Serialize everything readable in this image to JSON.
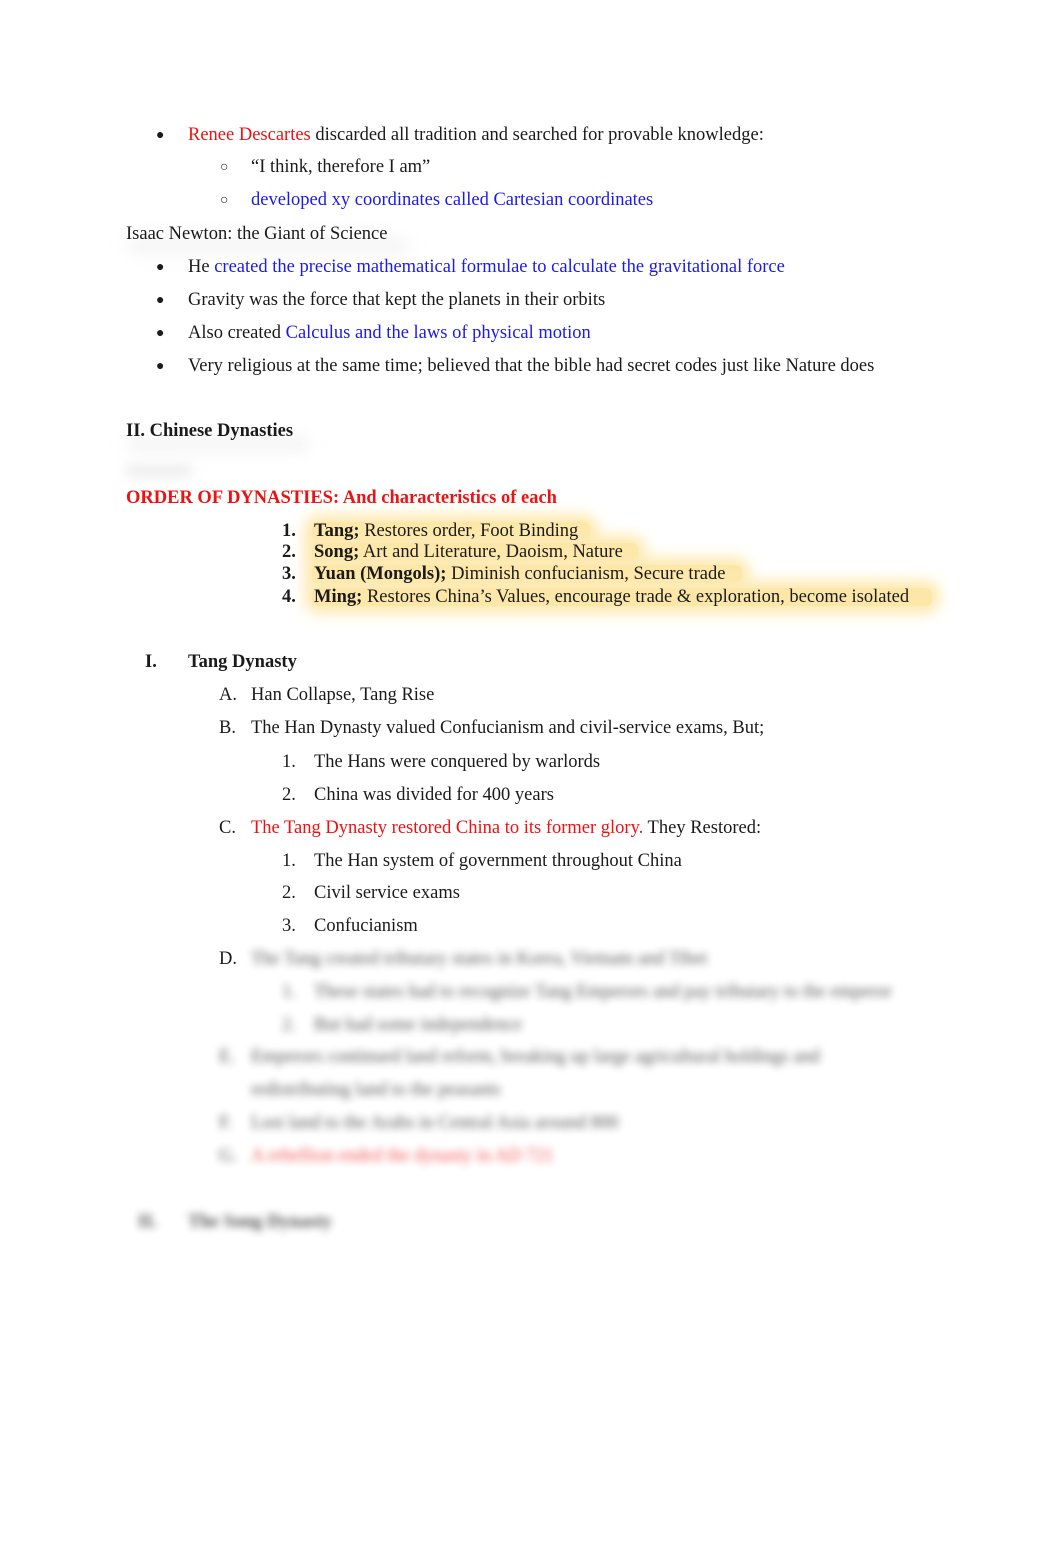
{
  "descartes": {
    "bullet": "●",
    "name": "Renee Descartes",
    "text": " discarded all tradition and searched for provable knowledge:",
    "sub": [
      {
        "marker": "○",
        "text": "“I think, therefore I am”",
        "color": "#1a1a1a"
      },
      {
        "marker": "○",
        "text": "developed xy coordinates called Cartesian coordinates",
        "color": "#1a1aee"
      }
    ]
  },
  "newton": {
    "heading": "Isaac Newton: the Giant of Science",
    "bullets": [
      {
        "marker": "●",
        "plain": "He ",
        "highlight": "created the precise mathematical formulae to calculate the gravitational force"
      },
      {
        "marker": "●",
        "plain": "Gravity was the force that kept the planets in their orbits",
        "highlight": ""
      },
      {
        "marker": "●",
        "plain": "Also created ",
        "highlight": "Calculus and the laws of physical motion"
      },
      {
        "marker": "●",
        "plain": "Very religious at the same time; believed that the bible had secret codes just like Nature does",
        "highlight": ""
      }
    ]
  },
  "section2": {
    "heading": "II. Chinese Dynasties",
    "order_heading": "ORDER OF DYNASTIES: And characteristics of each",
    "dynasties": [
      {
        "num": "1.",
        "name": "Tang;",
        "desc": " Restores order, Foot Binding"
      },
      {
        "num": "2.",
        "name": "Song;",
        "desc": " Art and Literature, Daoism, Nature"
      },
      {
        "num": "3.",
        "name": "Yuan (Mongols);",
        "desc": " Diminish confucianism, Secure trade"
      },
      {
        "num": "4.",
        "name": "Ming;",
        "desc": " Restores China’s Values, encourage trade & exploration, become isolated"
      }
    ]
  },
  "tang": {
    "numeral": "I.",
    "title": "Tang Dynasty",
    "items": [
      {
        "letter": "A.",
        "text": "Han Collapse, Tang Rise"
      },
      {
        "letter": "B.",
        "text": "The Han Dynasty valued Confucianism and civil-service exams, But;",
        "sub": [
          {
            "num": "1.",
            "text": "The Hans were conquered by warlords"
          },
          {
            "num": "2.",
            "text": "China was divided for 400 years"
          }
        ]
      },
      {
        "letter": "C.",
        "red": "The Tang Dynasty restored China to its former glory.",
        "text": " They Restored:",
        "sub": [
          {
            "num": "1.",
            "text": "The Han system of government throughout China"
          },
          {
            "num": "2.",
            "text": "Civil service exams"
          },
          {
            "num": "3.",
            "text": "Confucianism"
          }
        ]
      },
      {
        "letter": "D.",
        "text": "The Tang created tributary states in Korea, Vietnam and Tibet",
        "sub": [
          {
            "num": "1.",
            "text": "These states had to recognize Tang Emperors and pay tributary to the emperor"
          },
          {
            "num": "2.",
            "text": "But had some independence"
          }
        ]
      },
      {
        "letter": "E.",
        "text": "Emperors continued land reform, breaking up large agricultural holdings and",
        "text2": "redistributing land to the peasants"
      },
      {
        "letter": "F.",
        "text": "Lost land to the Arabs in Central Asia around 800"
      },
      {
        "letter": "G.",
        "red": "A rebellion ended the dynasty in AD 721"
      }
    ]
  },
  "song": {
    "numeral": "II.",
    "title": "The Song Dynasty"
  }
}
